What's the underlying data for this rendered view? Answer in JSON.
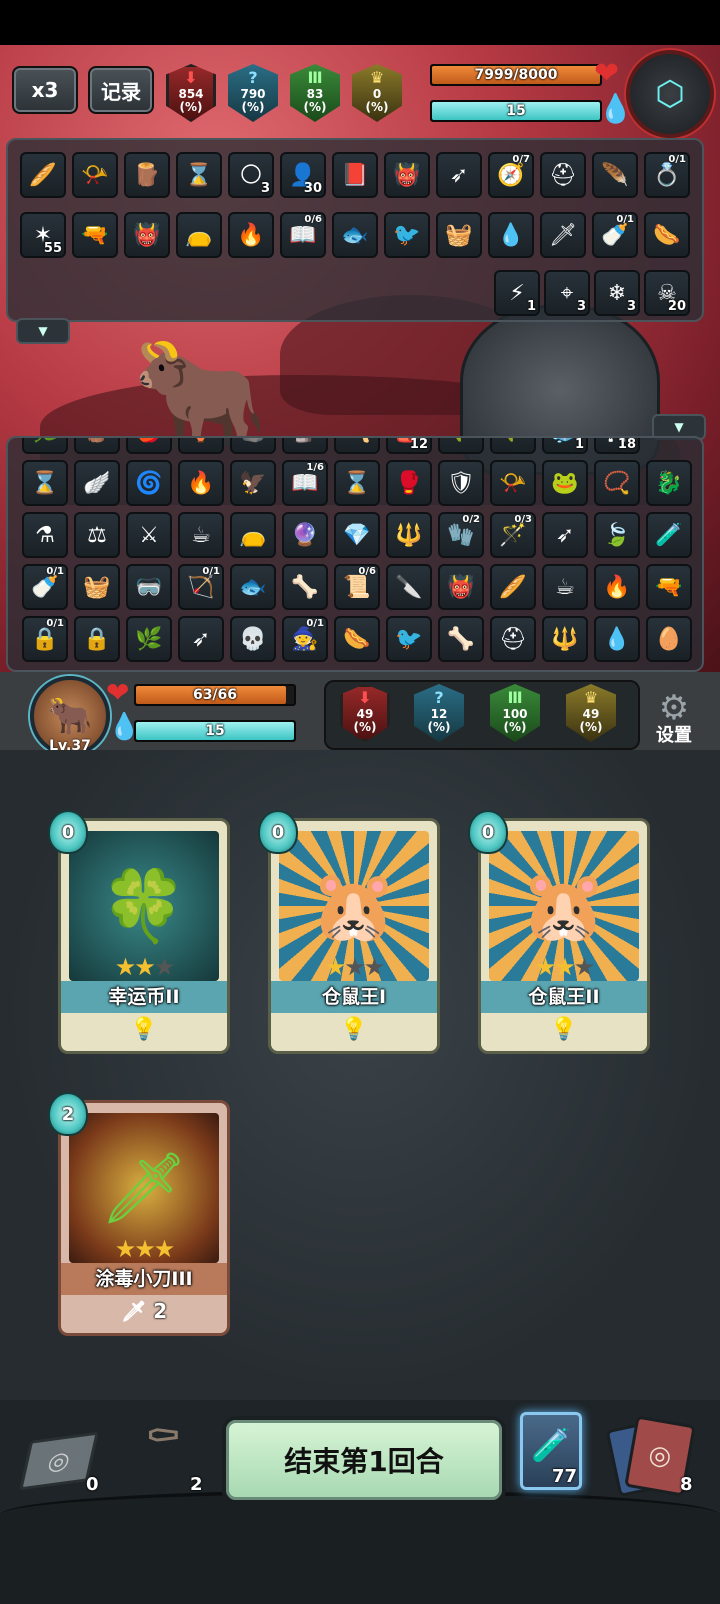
{
  "hud": {
    "speed_label": "x3",
    "log_label": "记录",
    "enemy_stats": [
      {
        "value": "854",
        "unit": "(%)",
        "icon": "attack-down-icon",
        "color": "#9a2a2a"
      },
      {
        "value": "790",
        "unit": "(%)",
        "icon": "mystery-icon",
        "color": "#2a6e86"
      },
      {
        "value": "83",
        "unit": "(%)",
        "icon": "defense-icon",
        "color": "#3a8a3a"
      },
      {
        "value": "0",
        "unit": "(%)",
        "icon": "crown-icon",
        "color": "#8a7a2a"
      }
    ],
    "enemy_hp": "7999/8000",
    "enemy_hp_fraction": 0.9999,
    "enemy_energy": "15"
  },
  "enemy_items": {
    "row1": [
      {
        "icon": "bread-icon"
      },
      {
        "icon": "horn-icon"
      },
      {
        "icon": "log-icon"
      },
      {
        "icon": "hourglass-icon"
      },
      {
        "icon": "moon-orb-icon",
        "count": "3"
      },
      {
        "icon": "hooded-figure-icon",
        "count": "30"
      },
      {
        "icon": "book-icon"
      },
      {
        "icon": "red-creature-icon"
      },
      {
        "icon": "arrows-icon"
      },
      {
        "icon": "compass-icon",
        "frac": "0/7"
      },
      {
        "icon": "helmet-icon"
      },
      {
        "icon": "wing-icon"
      },
      {
        "icon": "ring-icon",
        "frac": "0/1"
      }
    ],
    "row2": [
      {
        "icon": "claw-mark-icon",
        "count": "55"
      },
      {
        "icon": "gun-icon"
      },
      {
        "icon": "red-creature-icon"
      },
      {
        "icon": "sack-icon"
      },
      {
        "icon": "torch-icon"
      },
      {
        "icon": "spellbook-icon",
        "frac": "0/6"
      },
      {
        "icon": "fish-icon"
      },
      {
        "icon": "bird-icon"
      },
      {
        "icon": "basket-icon"
      },
      {
        "icon": "water-spirit-icon"
      },
      {
        "icon": "dagger-icon"
      },
      {
        "icon": "pacifier-icon",
        "frac": "0/1"
      },
      {
        "icon": "sausage-icon"
      }
    ],
    "statuses": [
      {
        "icon": "lightning-icon",
        "count": "1"
      },
      {
        "icon": "target-icon",
        "count": "3"
      },
      {
        "icon": "snowflake-icon",
        "count": "3"
      },
      {
        "icon": "poison-skull-icon",
        "count": "20"
      }
    ]
  },
  "player_items": {
    "row0": [
      {
        "icon": "plant-icon"
      },
      {
        "icon": "log-icon"
      },
      {
        "icon": "apple-icon"
      },
      {
        "icon": "pot-icon"
      },
      {
        "icon": "rock-icon"
      },
      {
        "icon": "statue-icon"
      },
      {
        "icon": "axe-icon"
      },
      {
        "icon": "bag-icon",
        "count": "12"
      },
      {
        "icon": "grass-icon"
      },
      {
        "icon": "grass-icon"
      },
      {
        "icon": "ice-icon",
        "count": "1"
      },
      {
        "icon": "gate-icon",
        "count": "18"
      }
    ],
    "row1": [
      {
        "icon": "hourglass-icon"
      },
      {
        "icon": "wings-icon"
      },
      {
        "icon": "green-swirl-icon"
      },
      {
        "icon": "fire-cup-icon"
      },
      {
        "icon": "rock-bird-icon"
      },
      {
        "icon": "spellbook-icon",
        "frac": "1/6"
      },
      {
        "icon": "hourglass-icon"
      },
      {
        "icon": "boxing-glove-icon"
      },
      {
        "icon": "armor-icon"
      },
      {
        "icon": "horn-icon"
      },
      {
        "icon": "frog-icon"
      },
      {
        "icon": "bracelet-icon"
      },
      {
        "icon": "fire-beast-icon"
      }
    ],
    "row2": [
      {
        "icon": "cauldron-icon"
      },
      {
        "icon": "scales-icon"
      },
      {
        "icon": "sword-icon"
      },
      {
        "icon": "teacup-icon"
      },
      {
        "icon": "sack-icon"
      },
      {
        "icon": "blue-orb-icon"
      },
      {
        "icon": "crystal-icon"
      },
      {
        "icon": "spear-icon"
      },
      {
        "icon": "gauntlet-icon",
        "frac": "0/2"
      },
      {
        "icon": "staff-icon",
        "frac": "0/3"
      },
      {
        "icon": "arrows-icon"
      },
      {
        "icon": "leaf-blade-icon"
      },
      {
        "icon": "potion-bag-icon"
      }
    ],
    "row3": [
      {
        "icon": "pacifier-icon",
        "frac": "0/1"
      },
      {
        "icon": "basket-icon"
      },
      {
        "icon": "goggles-icon"
      },
      {
        "icon": "bow-icon",
        "frac": "0/1"
      },
      {
        "icon": "fish-icon"
      },
      {
        "icon": "claw-icon"
      },
      {
        "icon": "scroll-icon",
        "frac": "0/6"
      },
      {
        "icon": "knife-icon"
      },
      {
        "icon": "red-creature-icon"
      },
      {
        "icon": "bread-icon"
      },
      {
        "icon": "teacup-icon"
      },
      {
        "icon": "torch-icon"
      },
      {
        "icon": "gun-icon"
      }
    ],
    "row4": [
      {
        "icon": "locked-slot-icon",
        "frac": "0/1"
      },
      {
        "icon": "locked-slot-icon"
      },
      {
        "icon": "laurel-icon"
      },
      {
        "icon": "arrows-icon"
      },
      {
        "icon": "skull-badge-icon"
      },
      {
        "icon": "mage-icon",
        "frac": "0/1"
      },
      {
        "icon": "sausage-icon"
      },
      {
        "icon": "bird-icon"
      },
      {
        "icon": "bone-icon"
      },
      {
        "icon": "helmet-icon"
      },
      {
        "icon": "pitchfork-icon"
      },
      {
        "icon": "water-spirit-icon"
      },
      {
        "icon": "egg-icon"
      }
    ]
  },
  "player": {
    "level": "Lv.37",
    "hp": "63/66",
    "hp_fraction": 0.9545,
    "energy": "15",
    "stats": [
      {
        "value": "49",
        "unit": "(%)",
        "icon": "attack-down-icon"
      },
      {
        "value": "12",
        "unit": "(%)",
        "icon": "mystery-icon"
      },
      {
        "value": "100",
        "unit": "(%)",
        "icon": "defense-icon"
      },
      {
        "value": "49",
        "unit": "(%)",
        "icon": "crown-icon"
      }
    ],
    "settings_label": "设置"
  },
  "hand": [
    {
      "name": "幸运币II",
      "cost": "0",
      "stars": 2,
      "max_stars": 3,
      "art": "clover-coin-icon",
      "footer_icon": "lightbulb-icon"
    },
    {
      "name": "仓鼠王I",
      "cost": "0",
      "stars": 1,
      "max_stars": 3,
      "art": "hamster-king-icon",
      "footer_icon": "lightbulb-icon"
    },
    {
      "name": "仓鼠王II",
      "cost": "0",
      "stars": 2,
      "max_stars": 3,
      "art": "hamster-king-icon",
      "footer_icon": "lightbulb-icon"
    },
    {
      "name": "涂毒小刀III",
      "cost": "2",
      "stars": 3,
      "max_stars": 3,
      "art": "poison-dagger-icon",
      "footer_value": "2"
    }
  ],
  "bottom": {
    "discard_count": "0",
    "grave_count": "2",
    "end_turn_label": "结束第1回合",
    "draw_count": "77",
    "deck_count": "8"
  }
}
